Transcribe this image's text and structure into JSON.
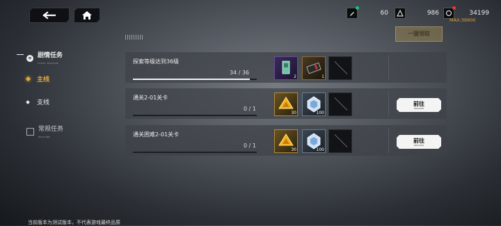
{
  "topbar": {
    "back_icon": "back-arrow-icon",
    "home_icon": "home-icon",
    "resources": [
      {
        "icon": "energy-pencil-icon",
        "value": "60",
        "dot": "#19c27a"
      },
      {
        "icon": "triangle-token-icon",
        "value": "986",
        "dot": ""
      },
      {
        "icon": "currency-icon",
        "value": "34199",
        "dot": "#e53a3a"
      }
    ],
    "max_label": "MAX:39900"
  },
  "claim_all_label": "一键领取",
  "sidebar": {
    "section1": {
      "label": "剧情任务",
      "sub": "STORY MISSION"
    },
    "items": [
      {
        "label": "主线",
        "active": true
      },
      {
        "label": "支线",
        "active": false
      }
    ],
    "section2": {
      "label": "常规任务",
      "sub": "ROUTINE"
    }
  },
  "tasks": [
    {
      "title": "探索等级达到36级",
      "progress_text": "34 / 36",
      "progress": 0.944,
      "rewards": [
        {
          "icon": "card-icon",
          "count": "2"
        },
        {
          "icon": "ticket-icon",
          "count": "1"
        },
        {
          "icon": "empty-slot",
          "count": ""
        }
      ],
      "button": null
    },
    {
      "title": "通关2-01关卡",
      "progress_text": "0 / 1",
      "progress": 0,
      "rewards": [
        {
          "icon": "gold-gem-icon",
          "count": "30"
        },
        {
          "icon": "blue-crystal-icon",
          "count": "100"
        },
        {
          "icon": "empty-slot",
          "count": ""
        }
      ],
      "button": {
        "label": "前往",
        "sub": "PROCEED"
      }
    },
    {
      "title": "通关困难2-01关卡",
      "progress_text": "0 / 1",
      "progress": 0,
      "rewards": [
        {
          "icon": "gold-gem-icon",
          "count": "30"
        },
        {
          "icon": "blue-crystal-icon",
          "count": "100"
        },
        {
          "icon": "empty-slot",
          "count": ""
        }
      ],
      "button": {
        "label": "前往",
        "sub": "PROCEED"
      }
    }
  ],
  "footer_text": "当前版本为测试版本，不代表游戏最终品质"
}
